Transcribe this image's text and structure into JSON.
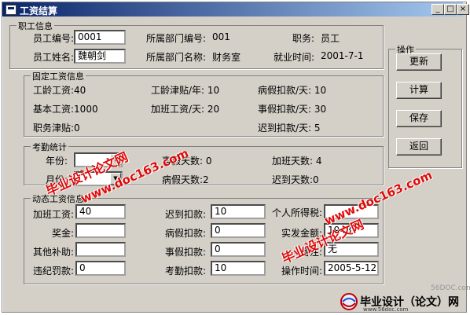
{
  "window": {
    "title": "工资结算"
  },
  "employee": {
    "group_label": "职工信息",
    "id_label": "员工编号:",
    "id_value": "0001",
    "dept_id_label": "所属部门编号:",
    "dept_id_value": "001",
    "position_label": "职务:",
    "position_value": "员工",
    "name_label": "员工姓名:",
    "name_value": "魏朝剑",
    "dept_name_label": "所属部门名称:",
    "dept_name_value": "财务室",
    "hire_label": "就业时间:",
    "hire_value": "2001-7-1"
  },
  "fixed": {
    "group_label": "固定工资信息",
    "seniority_pay": "工龄工资:40",
    "seniority_subsidy": "工龄津贴/年: 10",
    "sick_deduct": "病假扣款/天: 10",
    "base_pay": "基本工资:1000",
    "overtime_pay": "加班工资/天: 20",
    "leave_deduct": "事假扣款/天: 30",
    "position_subsidy": "职务津贴:0",
    "late_deduct": "迟到扣款/天: 5"
  },
  "attendance": {
    "group_label": "考勤统计",
    "year_label": "年份:",
    "year_value": "",
    "month_label": "月份:",
    "month_value": "",
    "leave_days": "事假天数: 0",
    "sick_days": "病假天数:2",
    "overtime_days": "加班天数: 4",
    "late_days": "迟到天数:0"
  },
  "dynamic": {
    "group_label": "动态工资信息",
    "overtime_label": "加班工资:",
    "overtime_value": "40",
    "late_label": "迟到扣款:",
    "late_value": "10",
    "tax_label": "个人所得税:",
    "tax_value": "",
    "bonus_label": "奖金:",
    "bonus_value": "",
    "sick_label": "病假扣款:",
    "sick_value": "0",
    "actual_label": "实发金额:",
    "actual_value": "1943",
    "other_label": "其他补助:",
    "other_value": "",
    "leave_label": "事假扣款:",
    "leave_value": "0",
    "remark_label": "备注:",
    "remark_value": "无",
    "penalty_label": "违纪罚款:",
    "penalty_value": "0",
    "attendance_label": "考勤扣款:",
    "attendance_value": "10",
    "optime_label": "操作时间:",
    "optime_value": "2005-5-12"
  },
  "actions": {
    "group_label": "操作",
    "update": "更新",
    "calc": "计算",
    "save": "保存",
    "back": "返回"
  },
  "watermarks": {
    "wm1a": "毕业设计论文网",
    "wm1b": "www.doc163.com",
    "wm2a": "毕业设计论文网",
    "wm2b": "www.doc163.com",
    "corner_site": "56DOC.com",
    "footer": "毕业设计（论文）网",
    "footer_url": "www.56doc.com"
  },
  "colors": {
    "title_start": "#0a246a",
    "title_end": "#a6caf0",
    "watermark": "#e00000",
    "dialog_bg": "#d4d0c8"
  }
}
